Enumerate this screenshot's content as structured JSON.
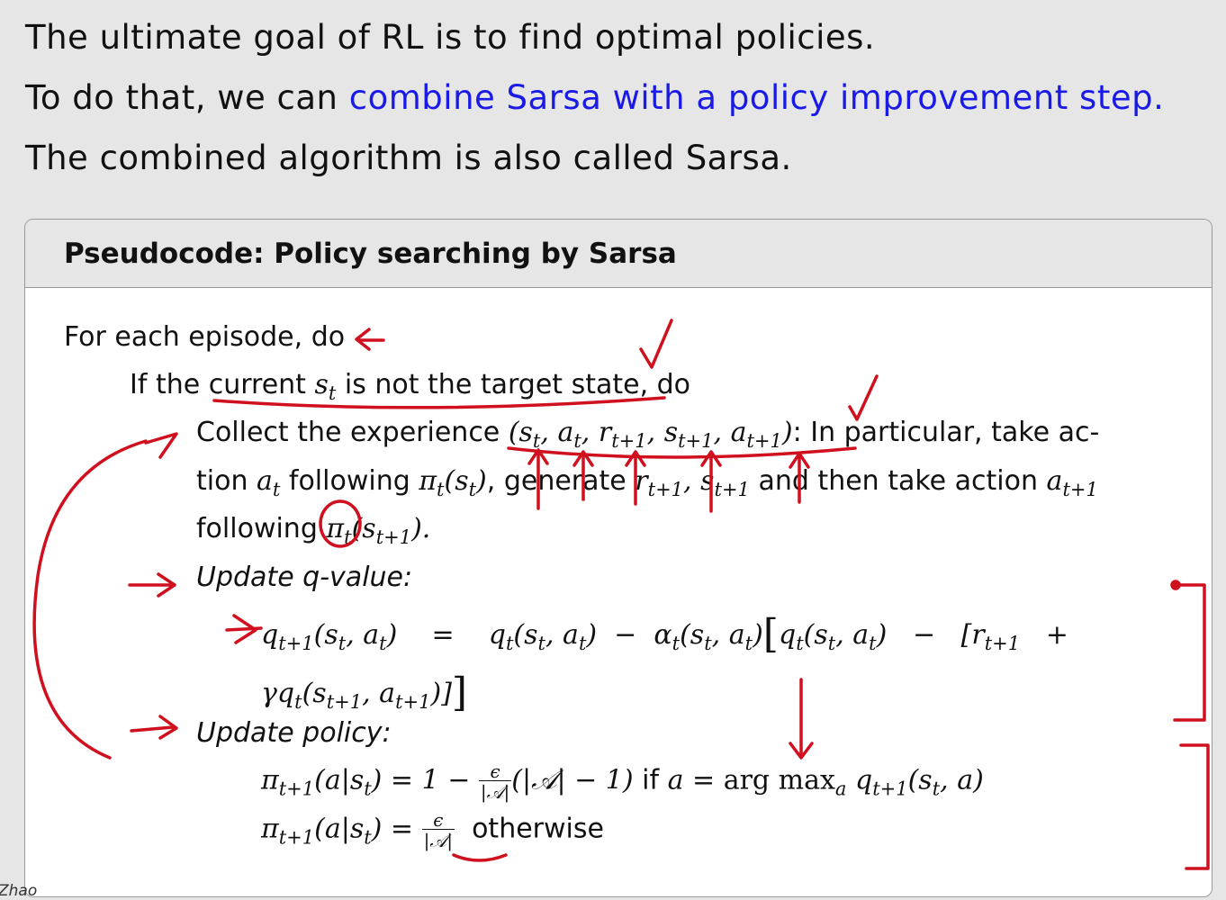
{
  "intro": {
    "line1": "The ultimate goal of RL is to find optimal policies.",
    "line2_plain": "To do that, we can ",
    "line2_link": "combine Sarsa with a policy improvement step.",
    "line3": "The combined algorithm is also called Sarsa."
  },
  "box": {
    "title": "Pseudocode: Policy searching by Sarsa",
    "for_each": "For each episode, do",
    "if_line": {
      "prefix": "If the current ",
      "middle": " is not the target state, do"
    },
    "collect": {
      "a": "Collect the experience ",
      "b": ": In particular, take ac-",
      "c": "tion ",
      "d": " following ",
      "e": ", generate ",
      "f": " and then take action ",
      "g": "following "
    },
    "update_q_label": "Update q-value:",
    "update_policy_label": "Update policy:",
    "policy_if": " if ",
    "policy_otherwise": "otherwise"
  },
  "footer": {
    "author": "Zhao"
  },
  "colors": {
    "link": "#1a1ae6",
    "annotation": "#d0101e",
    "header_bg": "#e6e6e6"
  }
}
